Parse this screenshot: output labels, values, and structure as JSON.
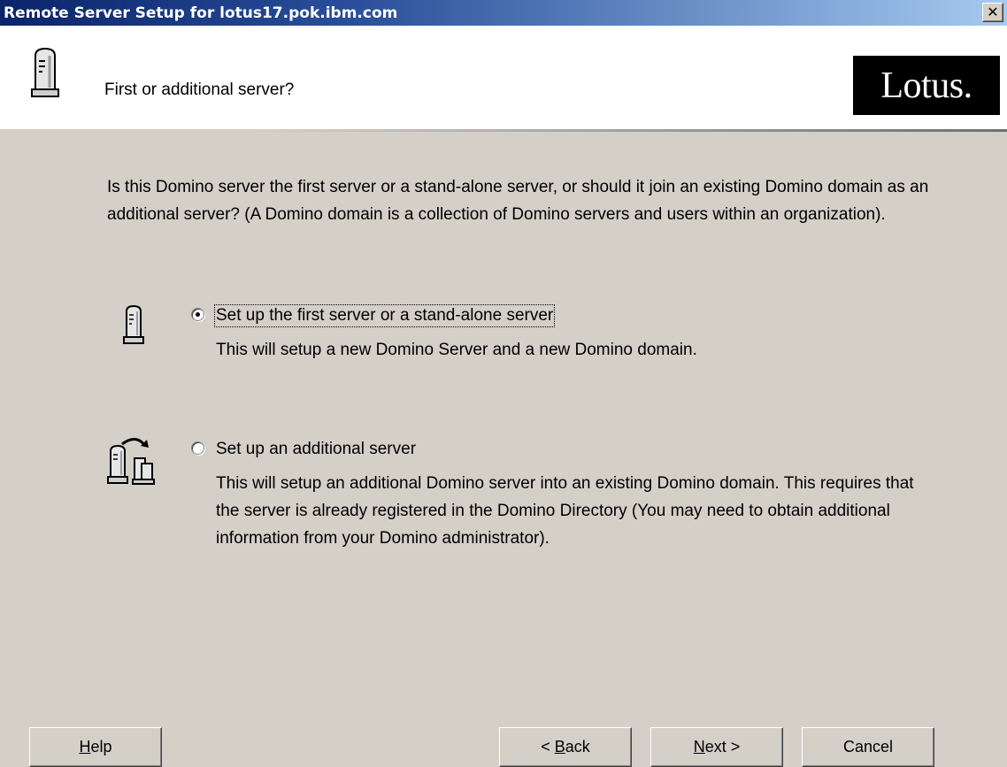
{
  "window": {
    "title": "Remote Server Setup for lotus17.pok.ibm.com",
    "close_glyph": "✕"
  },
  "header": {
    "title": "First or additional server?",
    "logo_text": "Lotus.",
    "icon": "server-icon"
  },
  "question": "Is this Domino server the first server or a stand-alone server, or should it join an existing Domino domain as an additional server? (A Domino domain is a collection of Domino servers and users within an organization).",
  "options": [
    {
      "label": "Set up the first server or a stand-alone server",
      "description": "This will setup a new Domino Server and a new Domino domain.",
      "selected": true,
      "icon": "server-icon"
    },
    {
      "label": "Set up an additional server",
      "description": "This will setup an additional Domino server into an existing Domino domain. This requires that the server is already registered in the Domino Directory (You may need to obtain additional information from your Domino administrator).",
      "selected": false,
      "icon": "add-server-icon"
    }
  ],
  "buttons": {
    "help": {
      "mnemonic": "H",
      "rest": "elp"
    },
    "back": {
      "prefix": "< ",
      "mnemonic": "B",
      "rest": "ack"
    },
    "next": {
      "mnemonic": "N",
      "rest": "ext >"
    },
    "cancel": "Cancel"
  },
  "colors": {
    "title_bar_start": "#0a246a",
    "title_bar_end": "#a6caf0",
    "dialog_background": "#d4d0c8",
    "header_background": "#ffffff",
    "logo_background": "#000000"
  }
}
